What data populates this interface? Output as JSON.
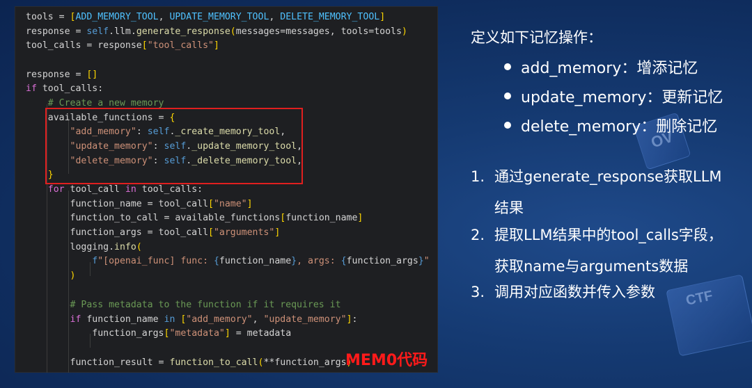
{
  "code": {
    "lines": [
      "tools = [ADD_MEMORY_TOOL, UPDATE_MEMORY_TOOL, DELETE_MEMORY_TOOL]",
      "response = self.llm.generate_response(messages=messages, tools=tools)",
      "tool_calls = response[\"tool_calls\"]",
      "",
      "response = []",
      "if tool_calls:",
      "    # Create a new memory",
      "    available_functions = {",
      "        \"add_memory\": self._create_memory_tool,",
      "        \"update_memory\": self._update_memory_tool,",
      "        \"delete_memory\": self._delete_memory_tool,",
      "    }",
      "    for tool_call in tool_calls:",
      "        function_name = tool_call[\"name\"]",
      "        function_to_call = available_functions[function_name]",
      "        function_args = tool_call[\"arguments\"]",
      "        logging.info(",
      "            f\"[openai_func] func: {function_name}, args: {function_args}\"",
      "        )",
      "",
      "        # Pass metadata to the function if it requires it",
      "        if function_name in [\"add_memory\", \"update_memory\"]:",
      "            function_args[\"metadata\"] = metadata",
      "",
      "        function_result = function_to_call(**function_args)"
    ],
    "caption": "MEM0代码"
  },
  "side": {
    "title": "定义如下记忆操作：",
    "bullets": [
      "add_memory：增添记忆",
      "update_memory：更新记忆",
      "delete_memory：删除记忆"
    ],
    "steps": [
      {
        "num": "1.",
        "line1": "通过generate_response获取LLM",
        "line2": "结果"
      },
      {
        "num": "2.",
        "line1": "提取LLM结果中的tool_calls字段，",
        "line2": "获取name与arguments数据"
      },
      {
        "num": "3.",
        "line1": "调用对应函数并传入参数",
        "line2": ""
      }
    ]
  },
  "decor": {
    "ov_label": "OV",
    "ctf_label": "CTF"
  },
  "colors": {
    "background": "#153a72",
    "code_bg": "#1e1f22",
    "highlight": "#e01f1f",
    "caption": "#ff1a1a"
  }
}
